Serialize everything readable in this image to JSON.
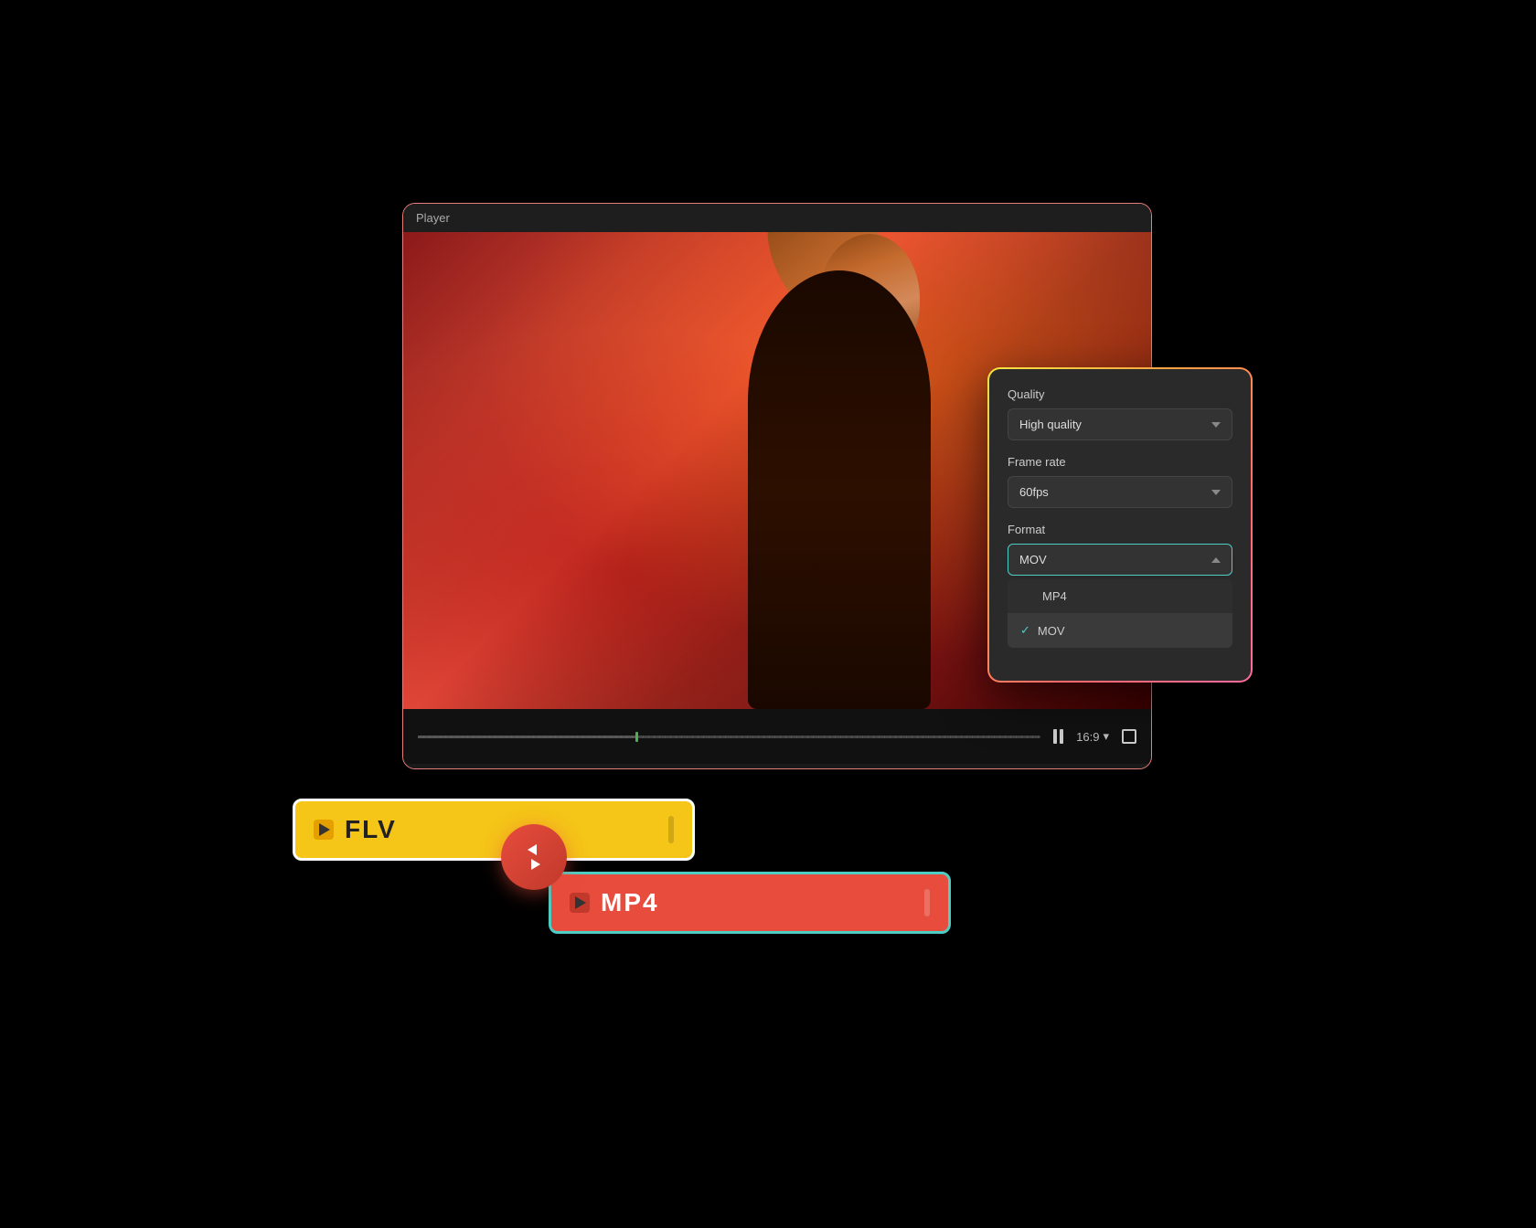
{
  "player": {
    "title": "Player",
    "controls": {
      "aspect_ratio": "16:9",
      "aspect_ratio_chevron": "▾"
    }
  },
  "settings": {
    "quality_label": "Quality",
    "quality_value": "High quality",
    "frame_rate_label": "Frame rate",
    "frame_rate_value": "60fps",
    "format_label": "Format",
    "format_value": "MOV",
    "format_options": [
      {
        "label": "MP4",
        "selected": false
      },
      {
        "label": "MOV",
        "selected": true
      }
    ]
  },
  "flv_badge": {
    "text": "FLV"
  },
  "mp4_badge": {
    "text": "MP4"
  },
  "colors": {
    "accent_teal": "#4ecdc4",
    "accent_yellow": "#f5c518",
    "accent_red": "#e74c3c",
    "panel_bg": "#2a2a2a",
    "dropdown_bg": "#333"
  }
}
